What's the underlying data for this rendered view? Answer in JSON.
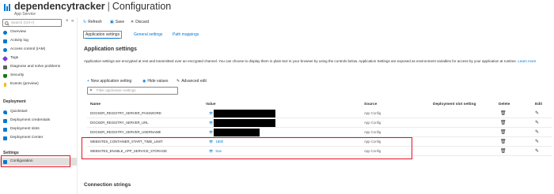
{
  "header": {
    "app_name": "dependencytracker",
    "separator": "|",
    "page_title": "Configuration",
    "subtitle": "App Service"
  },
  "sidebar": {
    "search_placeholder": "Search (Ctrl+/)",
    "collapse_glyph": "«",
    "items": [
      {
        "label": "Overview",
        "icon": "globe-icon",
        "color": "#0078d4"
      },
      {
        "label": "Activity log",
        "icon": "log-icon",
        "color": "#0078d4"
      },
      {
        "label": "Access control (IAM)",
        "icon": "people-icon",
        "color": "#0078d4"
      },
      {
        "label": "Tags",
        "icon": "tag-icon",
        "color": "#773adc"
      },
      {
        "label": "Diagnose and solve problems",
        "icon": "wrench-icon",
        "color": "#605e5c"
      },
      {
        "label": "Security",
        "icon": "shield-icon",
        "color": "#107c10"
      },
      {
        "label": "Events (preview)",
        "icon": "bolt-icon",
        "color": "#ffb900"
      }
    ],
    "deployment_header": "Deployment",
    "deployment_items": [
      {
        "label": "Quickstart",
        "icon": "rocket-icon",
        "color": "#0078d4"
      },
      {
        "label": "Deployment credentials",
        "icon": "credentials-icon",
        "color": "#0078d4"
      },
      {
        "label": "Deployment slots",
        "icon": "slots-icon",
        "color": "#0078d4"
      },
      {
        "label": "Deployment Center",
        "icon": "cube-icon",
        "color": "#0078d4"
      }
    ],
    "settings_header": "Settings",
    "settings_items": [
      {
        "label": "Configuration",
        "icon": "config-icon",
        "color": "#0078d4"
      }
    ]
  },
  "toolbar": {
    "refresh": "Refresh",
    "save": "Save",
    "discard": "Discard"
  },
  "tabs": [
    {
      "label": "Application settings"
    },
    {
      "label": "General settings"
    },
    {
      "label": "Path mappings"
    }
  ],
  "main": {
    "section_title": "Application settings",
    "description": "Application settings are encrypted at rest and transmitted over an encrypted channel. You can choose to display them in plain text in your browser by using the controls below. Application Settings are exposed as environment variables for access by your application at runtime.",
    "learn_more": "Learn more",
    "new_setting": "New application setting",
    "hide_values": "Hide values",
    "advanced_edit": "Advanced edit",
    "filter_placeholder": "Filter application settings",
    "connection_strings": "Connection strings"
  },
  "table": {
    "headers": {
      "name": "Name",
      "value": "Value",
      "source": "Source",
      "slot": "Deployment slot setting",
      "delete": "Delete",
      "edit": "Edit"
    },
    "rows": [
      {
        "name": "DOCKER_REGISTRY_SERVER_PASSWORD",
        "value": "",
        "source": "App Config",
        "redacted": true
      },
      {
        "name": "DOCKER_REGISTRY_SERVER_URL",
        "value": "",
        "source": "App Config",
        "redacted": true
      },
      {
        "name": "DOCKER_REGISTRY_SERVER_USERNAME",
        "value": "",
        "source": "App Config",
        "redacted": true
      },
      {
        "name": "WEBSITES_CONTAINER_START_TIME_LIMIT",
        "value": "1800",
        "source": "App Config",
        "redacted": false
      },
      {
        "name": "WEBSITES_ENABLE_APP_SERVICE_STORAGE",
        "value": "true",
        "source": "App Config",
        "redacted": false
      }
    ]
  },
  "colors": {
    "accent": "#0078d4",
    "highlight": "#e81123"
  }
}
